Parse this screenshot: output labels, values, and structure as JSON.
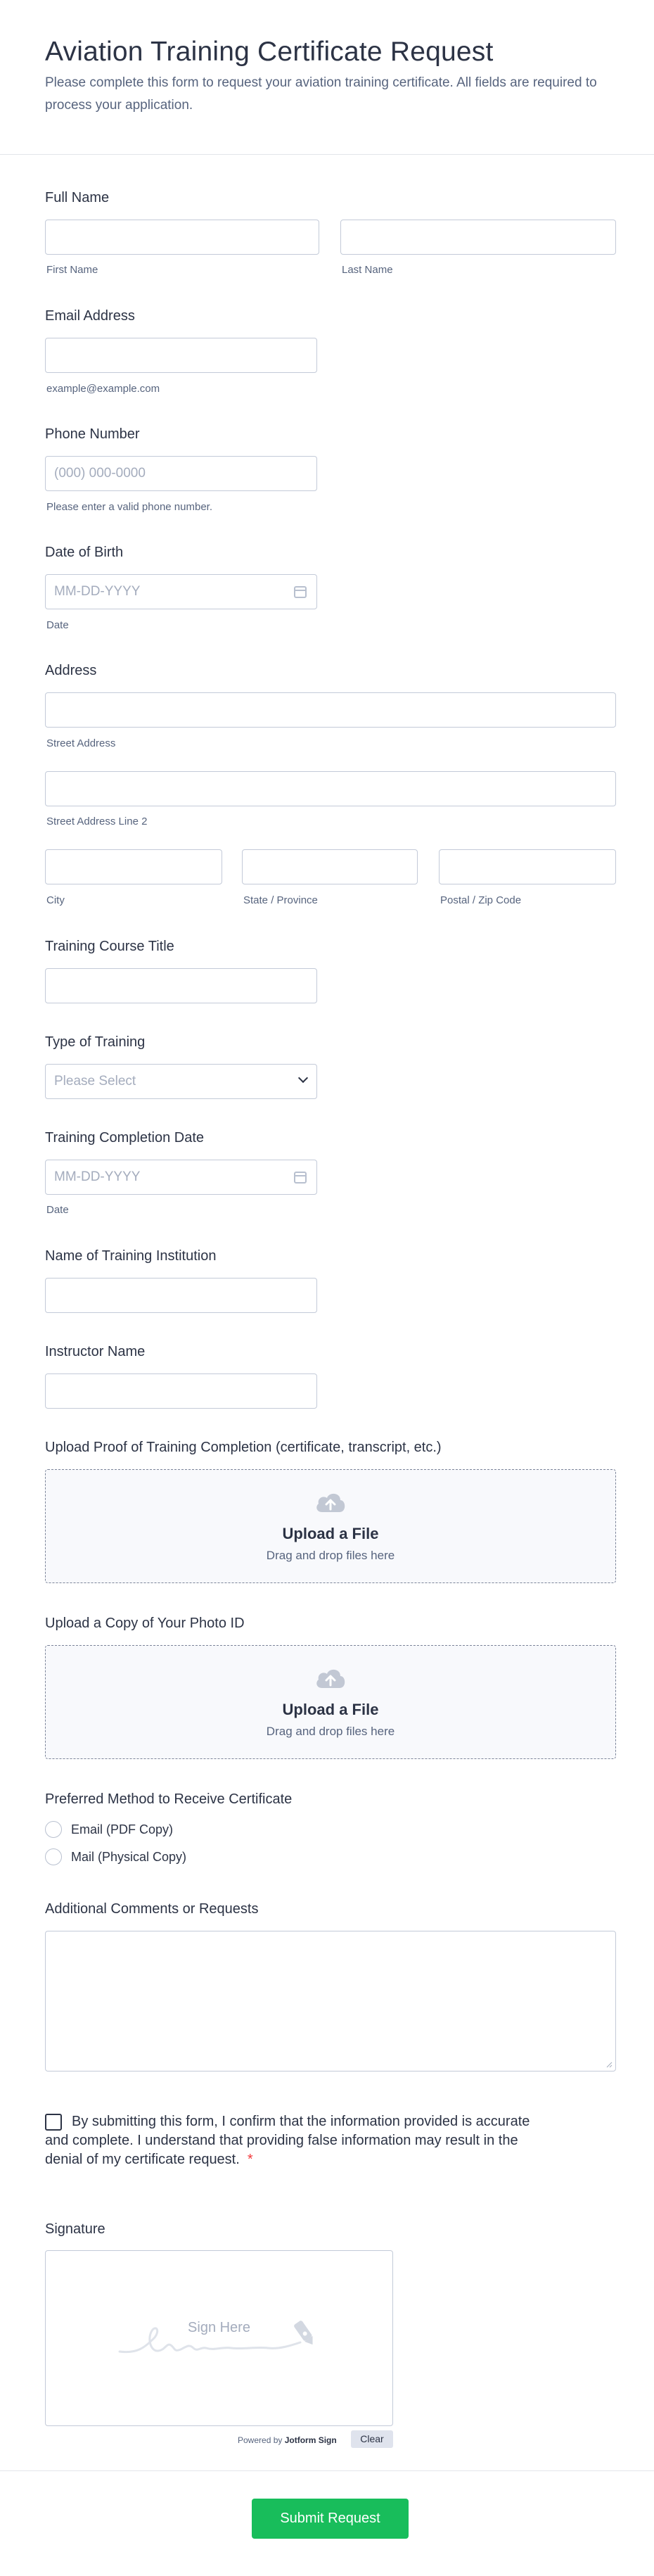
{
  "form": {
    "title": "Aviation Training Certificate Request",
    "subtitle": "Please complete this form to request your aviation training certificate. All fields are required to process your application."
  },
  "full_name": {
    "label": "Full Name",
    "first": "First Name",
    "last": "Last Name"
  },
  "email": {
    "label": "Email Address",
    "hint": "example@example.com"
  },
  "phone": {
    "label": "Phone Number",
    "placeholder": "(000) 000-0000",
    "hint": "Please enter a valid phone number."
  },
  "dob": {
    "label": "Date of Birth",
    "placeholder": "MM-DD-YYYY",
    "hint": "Date"
  },
  "address": {
    "label": "Address",
    "street": "Street Address",
    "street2": "Street Address Line 2",
    "city": "City",
    "state": "State / Province",
    "zip": "Postal / Zip Code"
  },
  "course_title": {
    "label": "Training Course Title"
  },
  "training_type": {
    "label": "Type of Training",
    "selected": "Please Select"
  },
  "completion_date": {
    "label": "Training Completion Date",
    "placeholder": "MM-DD-YYYY",
    "hint": "Date"
  },
  "institution": {
    "label": "Name of Training Institution"
  },
  "instructor": {
    "label": "Instructor Name"
  },
  "upload_proof": {
    "label": "Upload Proof of Training Completion (certificate, transcript, etc.)",
    "title": "Upload a File",
    "sub": "Drag and drop files here"
  },
  "upload_id": {
    "label": "Upload a Copy of Your Photo ID",
    "title": "Upload a File",
    "sub": "Drag and drop files here"
  },
  "method": {
    "label": "Preferred Method to Receive Certificate",
    "options": [
      "Email (PDF Copy)",
      "Mail (Physical Copy)"
    ]
  },
  "comments": {
    "label": "Additional Comments or Requests"
  },
  "consent": {
    "text": "By submitting this form, I confirm that the information provided is accurate and complete. I understand that providing false information may result in the denial of my certificate request.",
    "required_mark": "*"
  },
  "signature": {
    "label": "Signature",
    "placeholder": "Sign Here",
    "powered_by": "Powered by",
    "brand": "Jotform Sign",
    "clear": "Clear"
  },
  "submit": {
    "label": "Submit Request"
  },
  "colors": {
    "accent": "#18bd5b",
    "text": "#2c3345",
    "muted": "#57647e",
    "border": "#c3cad8",
    "required": "#f23a3c"
  }
}
